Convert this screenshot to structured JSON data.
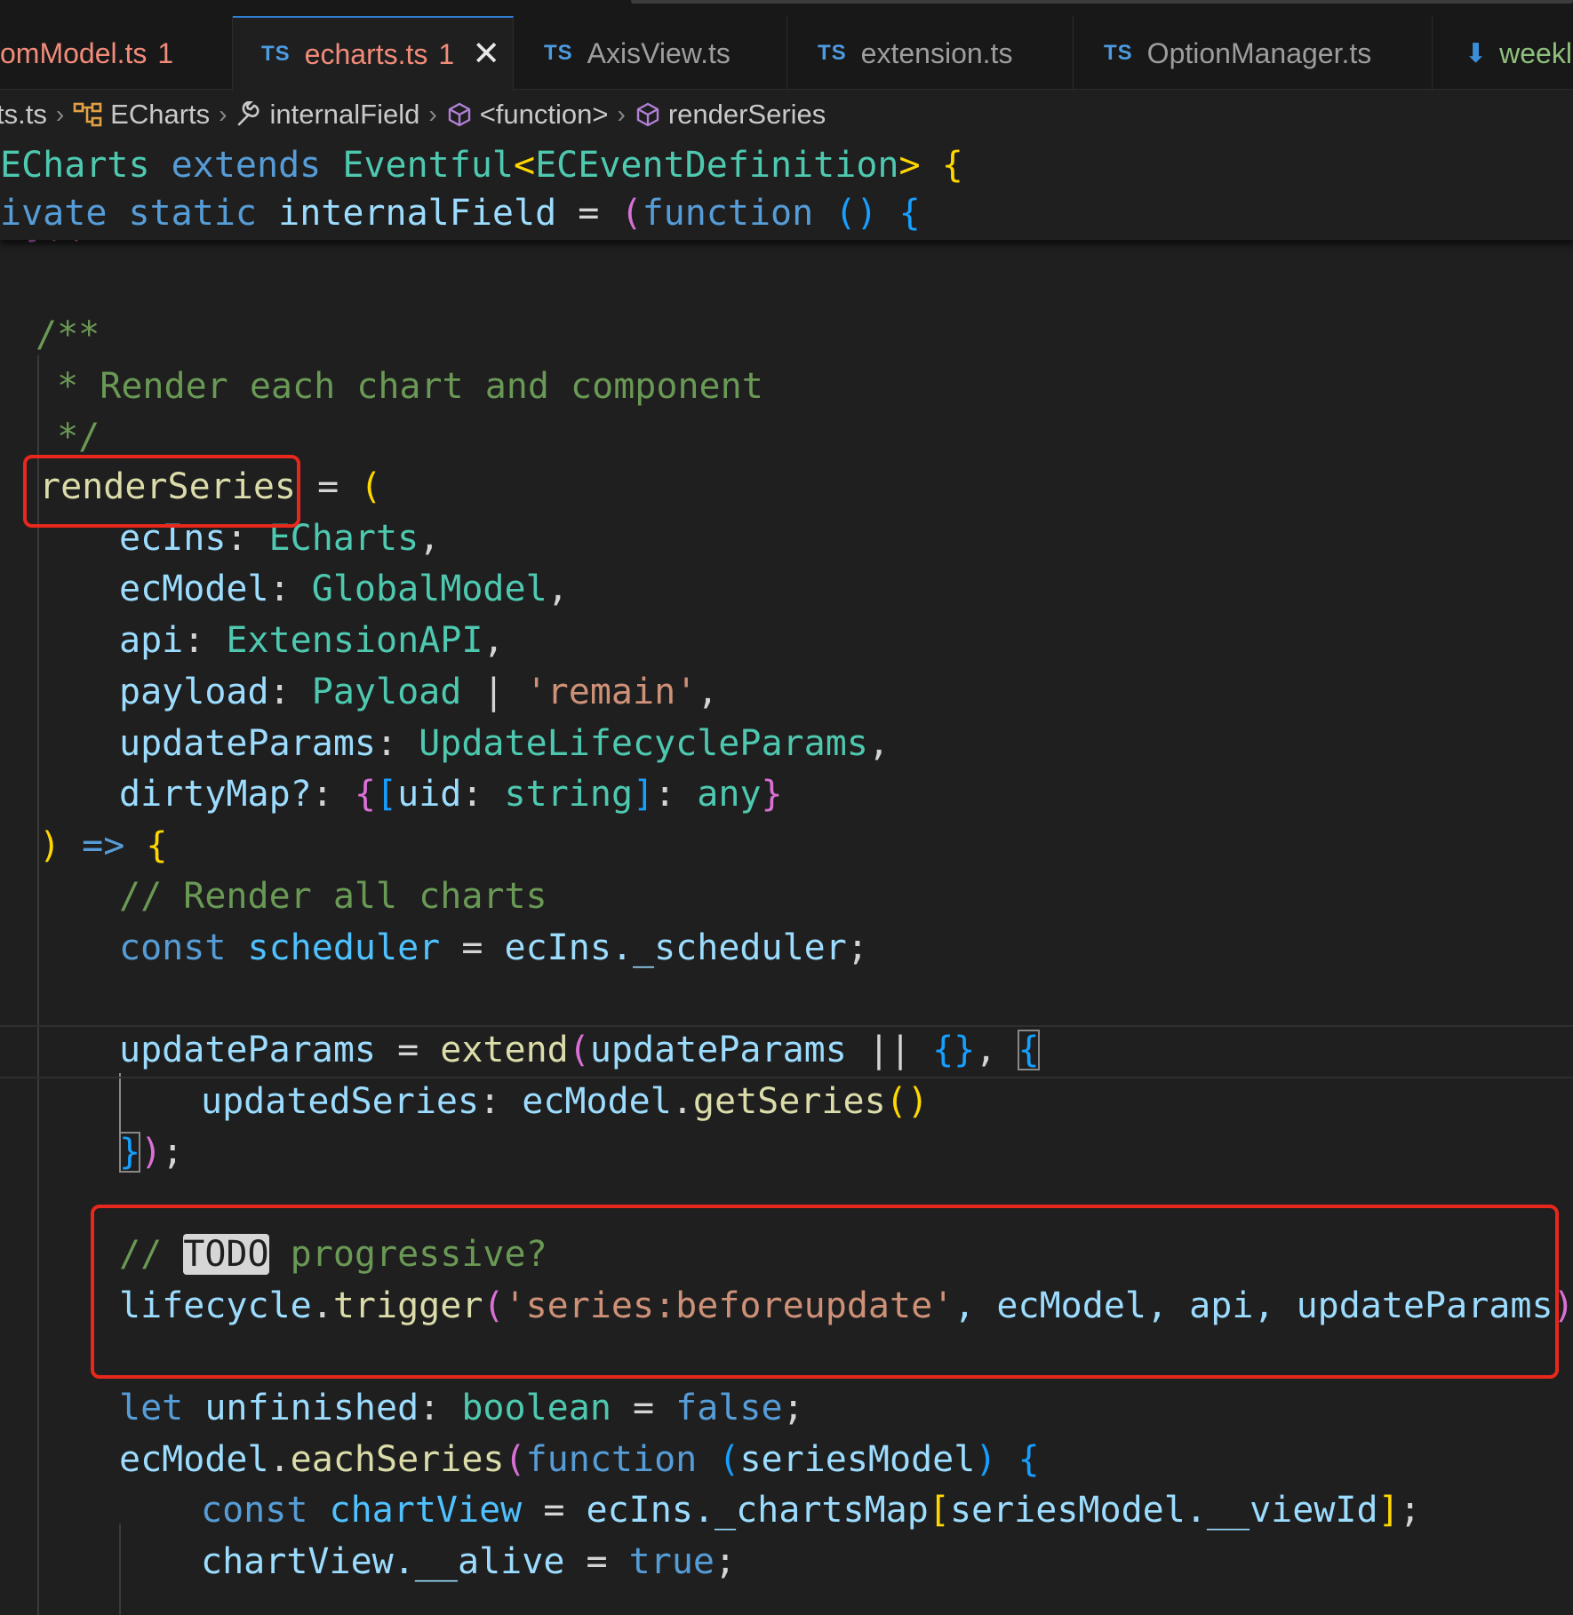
{
  "tabs": [
    {
      "icon": "",
      "label": "omModel.ts",
      "badge": "1",
      "active": false
    },
    {
      "icon": "TS",
      "label": "echarts.ts",
      "badge": "1",
      "active": true,
      "close": "✕"
    },
    {
      "icon": "TS",
      "label": "AxisView.ts",
      "active": false
    },
    {
      "icon": "TS",
      "label": "extension.ts",
      "active": false
    },
    {
      "icon": "TS",
      "label": "OptionManager.ts",
      "active": false
    },
    {
      "icon": "⬇",
      "label": "weekl",
      "active": false
    }
  ],
  "breadcrumb": [
    "ts.ts",
    "ECharts",
    "internalField",
    "<function>",
    "renderSeries"
  ],
  "sticky": {
    "line1": {
      "name": "ECharts",
      "extends": "extends",
      "base": "Eventful",
      "lt": "<",
      "param": "ECEventDefinition",
      "gt": ">",
      "brace": "{"
    },
    "line2": {
      "private": "ivate",
      "static": "static",
      "field": "internalField",
      "eq": "=",
      "paren": "(",
      "function": "function",
      "parens": "()",
      "brace": "{"
    }
  },
  "code": {
    "l_close": "});",
    "doc_open": "/**",
    "doc_text": " * Render each chart and component",
    "doc_close": " */",
    "fn_name": "renderSeries",
    "fn_eq": " = ",
    "fn_paren": "(",
    "params": [
      {
        "name": "ecIns",
        "colon": ": ",
        "type": "ECharts",
        "tail": ","
      },
      {
        "name": "ecModel",
        "colon": ": ",
        "type": "GlobalModel",
        "tail": ","
      },
      {
        "name": "api",
        "colon": ": ",
        "type": "ExtensionAPI",
        "tail": ","
      },
      {
        "name": "payload",
        "colon": ": ",
        "type": "Payload",
        "pipe": " | ",
        "str": "'remain'",
        "tail": ","
      },
      {
        "name": "updateParams",
        "colon": ": ",
        "type": "UpdateLifecycleParams",
        "tail": ","
      }
    ],
    "dirty": {
      "name": "dirtyMap?",
      "colon": ": ",
      "ob": "{",
      "sb": "[",
      "key": "uid",
      "kc": ": ",
      "kt": "string",
      "se": "]",
      "vc": ": ",
      "vt": "any",
      "cb": "}"
    },
    "arrow": {
      "paren": ")",
      "arrow": " => ",
      "brace": "{"
    },
    "c_render": "// Render all charts",
    "sched": {
      "kw": "const",
      "name": "scheduler",
      "eq": " = ",
      "obj": "ecIns",
      "prop": "._scheduler",
      "semi": ";"
    },
    "upd": {
      "name": "updateParams",
      "eq": " = ",
      "fn": "extend",
      "p": "(",
      "arg": "updateParams",
      "or": " || ",
      "empty": "{}",
      "comma": ", ",
      "ob": "{"
    },
    "upd2": {
      "key": "updatedSeries",
      "colon": ": ",
      "obj": "ecModel",
      "dot": ".",
      "fn": "getSeries",
      "p": "()"
    },
    "upd3": {
      "cb": "}",
      "p": ")",
      "semi": ";"
    },
    "todo": {
      "slashes": "// ",
      "word": "TODO",
      "rest": " progressive?"
    },
    "trig": {
      "obj": "lifecycle",
      "dot": ".",
      "fn": "trigger",
      "p": "(",
      "str": "'series:beforeupdate'",
      "args": ", ecModel, api, updateParams",
      "pc": ")",
      "semi": ";"
    },
    "unf": {
      "kw": "let",
      "name": "unfinished",
      "colon": ": ",
      "type": "boolean",
      "eq": " = ",
      "val": "false",
      "semi": ";"
    },
    "each": {
      "obj": "ecModel",
      "dot": ".",
      "fn": "eachSeries",
      "p": "(",
      "kw": "function",
      "sp": " ",
      "pp": "(",
      "arg": "seriesModel",
      "pc": ")",
      "brace": " {"
    },
    "cv": {
      "kw": "const",
      "name": "chartView",
      "eq": " = ",
      "obj": "ecIns",
      "prop": "._chartsMap",
      "sb": "[",
      "arg": "seriesModel.__viewId",
      "se": "]",
      "semi": ";"
    },
    "alive": {
      "obj": "chartView",
      "prop": ".__alive",
      "eq": " = ",
      "val": "true",
      "semi": ";"
    }
  },
  "colors": {
    "annotation": "#e8281c",
    "accent": "#2f7fd6"
  }
}
